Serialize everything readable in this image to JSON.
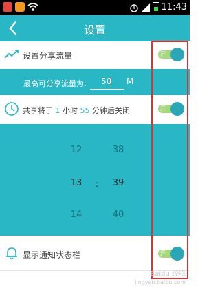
{
  "status_bar": {
    "time": "11:43",
    "icons": [
      "app-red-icon",
      "app-orange-icon",
      "wifi-icon",
      "alarm-icon",
      "signal-icon",
      "battery-icon"
    ]
  },
  "header": {
    "title": "设置",
    "back_icon": "chevron-left-icon"
  },
  "rows": {
    "share_traffic": {
      "label": "设置分享流量",
      "icon": "trend-line-icon",
      "toggle": {
        "on": true,
        "label": "开"
      }
    },
    "traffic_limit": {
      "label": "最高可分享流量为:",
      "value": "50",
      "unit": "M"
    },
    "auto_close": {
      "prefix": "共享将于",
      "hours": "1",
      "hours_unit": "小时",
      "minutes": "55",
      "suffix": "分钟后关闭",
      "icon": "clock-icon",
      "toggle": {
        "on": true,
        "label": "开"
      }
    },
    "time_picker": {
      "hours": [
        "12",
        "13",
        "14"
      ],
      "separator": ":",
      "minutes": [
        "38",
        "39",
        "40"
      ]
    },
    "notification": {
      "label": "显示通知状态栏",
      "icon": "bell-icon",
      "toggle": {
        "on": true,
        "label": "开"
      }
    }
  },
  "watermark": {
    "text": "Baidu 经验",
    "sub": "jingyan.baidu.com"
  },
  "colors": {
    "accent": "#29b6c5",
    "toggle_track": "#a5d97c",
    "toggle_knob": "#2aa6b6",
    "annotation_red": "#e03030"
  }
}
